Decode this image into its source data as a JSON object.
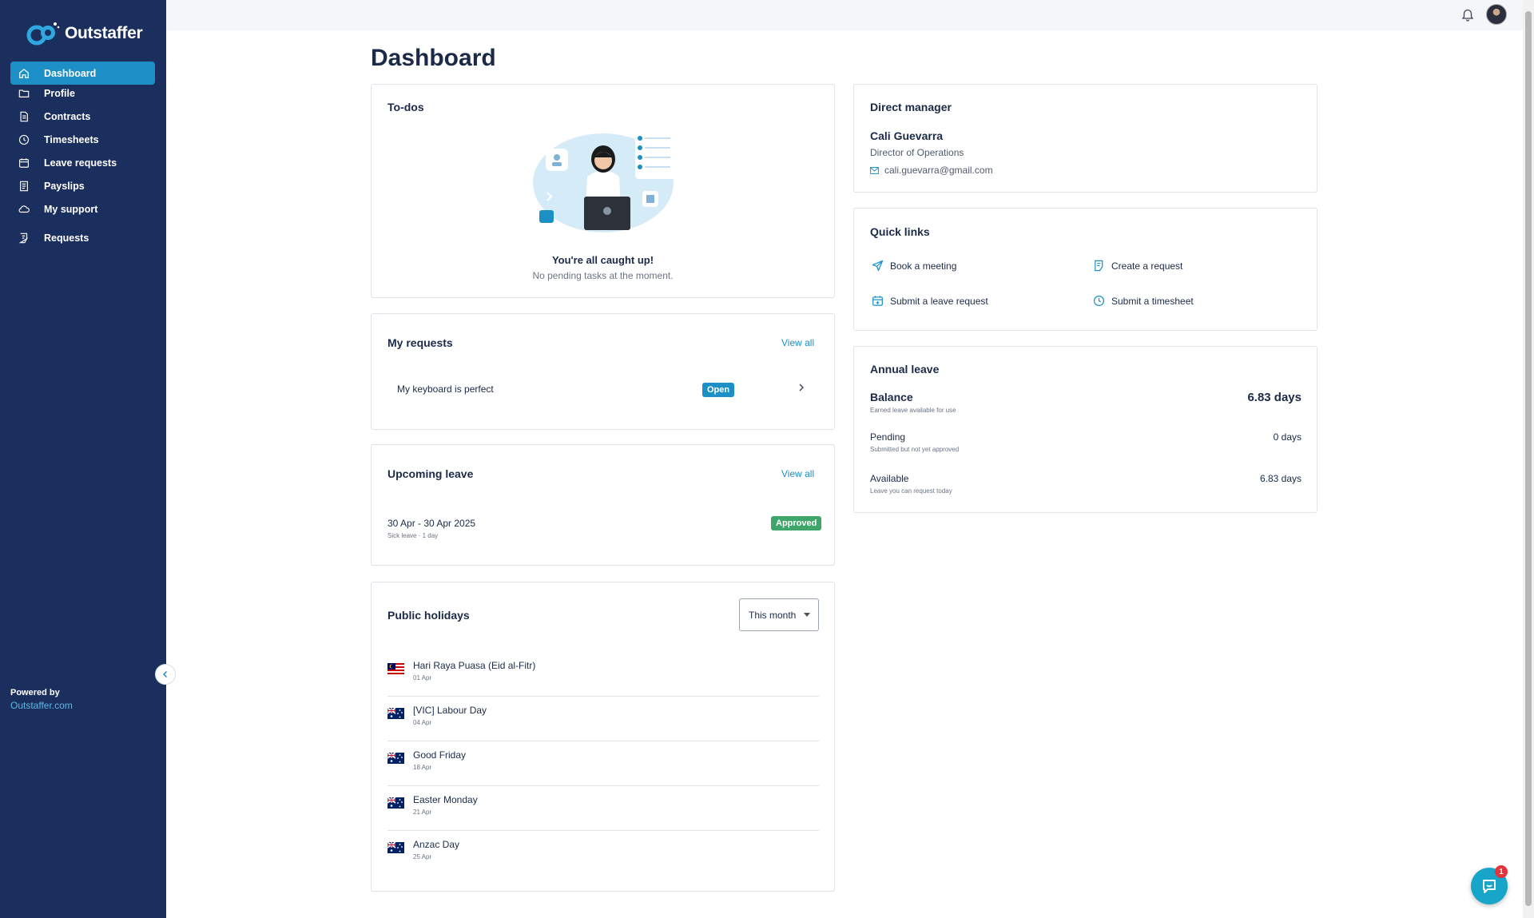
{
  "brand": {
    "name": "Outstaffer",
    "powered_by": "Powered by",
    "powered_link": "Outstaffer.com"
  },
  "sidebar": {
    "items": [
      {
        "label": "Dashboard",
        "icon": "home-icon",
        "active": true
      },
      {
        "label": "Profile",
        "icon": "folder-icon"
      },
      {
        "label": "Contracts",
        "icon": "document-icon"
      },
      {
        "label": "Timesheets",
        "icon": "clock-icon"
      },
      {
        "label": "Leave requests",
        "icon": "calendar-icon"
      },
      {
        "label": "Payslips",
        "icon": "receipt-icon"
      },
      {
        "label": "My support",
        "icon": "support-cloud-icon"
      },
      {
        "label": "Requests",
        "icon": "request-icon"
      }
    ]
  },
  "header": {
    "title": "Dashboard"
  },
  "todos": {
    "title": "To-dos",
    "heading": "You're all caught up!",
    "subtext": "No pending tasks at the moment."
  },
  "requests": {
    "title": "My requests",
    "view_all": "View all",
    "items": [
      {
        "title": "My keyboard is perfect",
        "status": "Open"
      }
    ]
  },
  "upcoming_leave": {
    "title": "Upcoming leave",
    "view_all": "View all",
    "items": [
      {
        "dates": "30 Apr - 30 Apr 2025",
        "detail": "Sick leave · 1 day",
        "status": "Approved"
      }
    ]
  },
  "holidays": {
    "title": "Public holidays",
    "filter": "This month",
    "items": [
      {
        "name": "Hari Raya Puasa (Eid al-Fitr)",
        "date": "01 Apr",
        "flag": "malaysia"
      },
      {
        "name": "[VIC] Labour Day",
        "date": "04 Apr",
        "flag": "australia"
      },
      {
        "name": "Good Friday",
        "date": "18 Apr",
        "flag": "australia"
      },
      {
        "name": "Easter Monday",
        "date": "21 Apr",
        "flag": "australia"
      },
      {
        "name": "Anzac Day",
        "date": "25 Apr",
        "flag": "australia"
      }
    ]
  },
  "manager": {
    "title": "Direct manager",
    "name": "Cali Guevarra",
    "role": "Director of Operations",
    "email": "cali.guevarra@gmail.com"
  },
  "quick_links": {
    "title": "Quick links",
    "items": [
      {
        "label": "Book a meeting",
        "icon": "send-icon"
      },
      {
        "label": "Create a request",
        "icon": "request-icon"
      },
      {
        "label": "Submit a leave request",
        "icon": "calendar-add-icon"
      },
      {
        "label": "Submit a timesheet",
        "icon": "clock-icon"
      }
    ]
  },
  "annual_leave": {
    "title": "Annual leave",
    "rows": [
      {
        "label": "Balance",
        "sub": "Earned leave available for use",
        "value": "6.83 days"
      },
      {
        "label": "Pending",
        "sub": "Submitted but not yet approved",
        "value": "0 days"
      },
      {
        "label": "Available",
        "sub": "Leave you can request today",
        "value": "6.83 days"
      }
    ]
  },
  "chat": {
    "unread": "1"
  },
  "colors": {
    "sidebar": "#1b2f5e",
    "accent": "#1c8fc7",
    "approved": "#3ea66b",
    "badge": "#e5333b"
  }
}
